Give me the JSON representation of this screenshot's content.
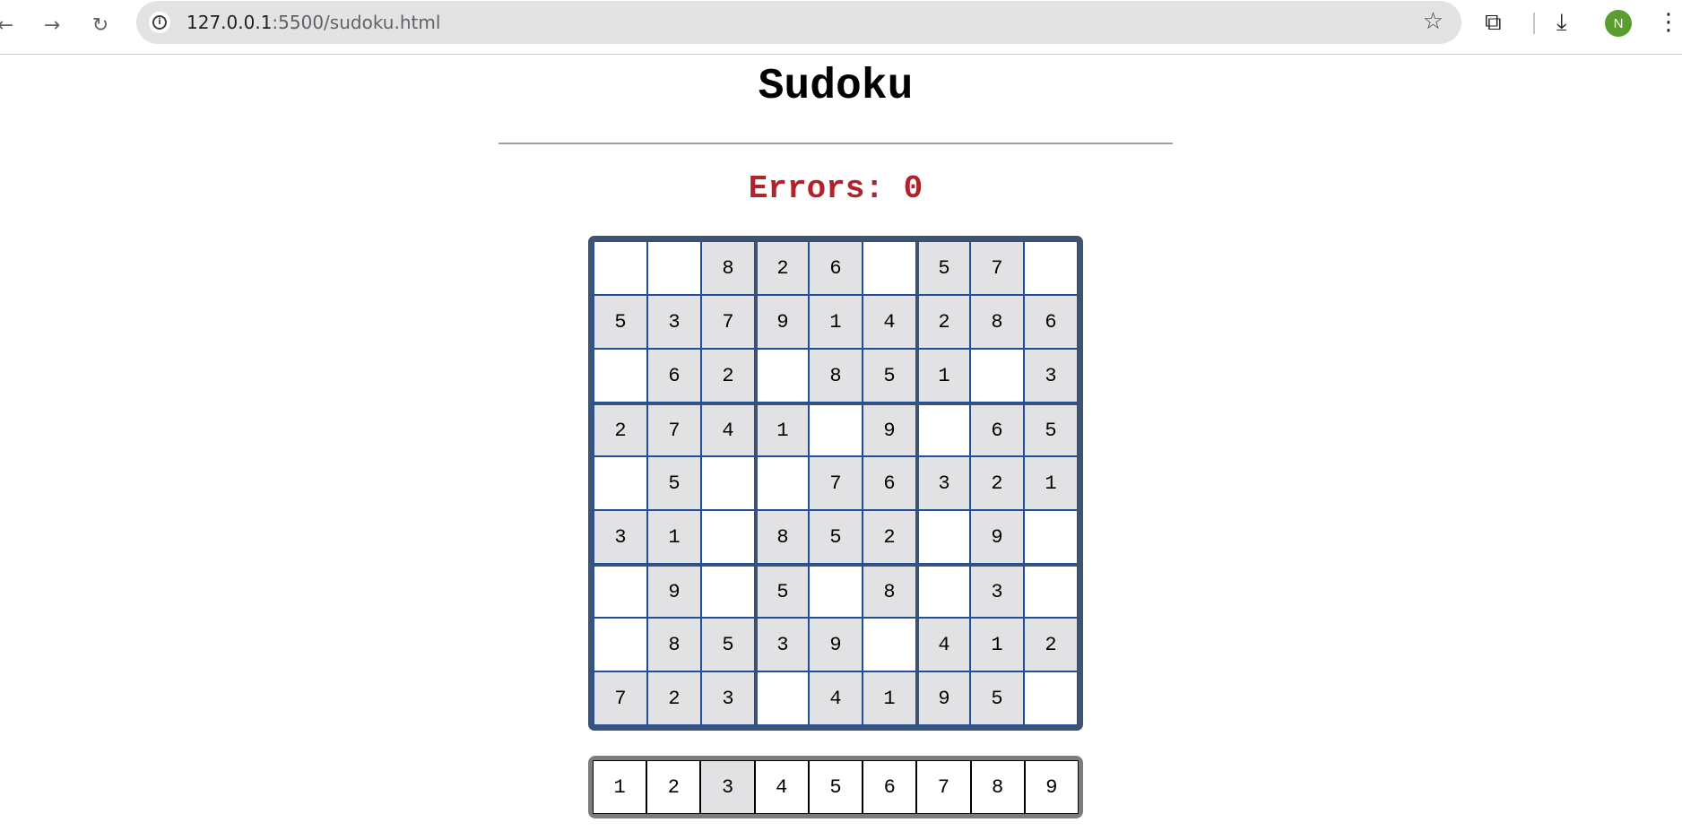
{
  "browser": {
    "url_host": "127.0.0.1",
    "url_path": ":5500/sudoku.html",
    "profile_initial": "N"
  },
  "page": {
    "title": "Sudoku",
    "errors_text": "Errors: 0"
  },
  "board": [
    [
      "",
      "",
      "8",
      "2",
      "6",
      "",
      "5",
      "7",
      ""
    ],
    [
      "5",
      "3",
      "7",
      "9",
      "1",
      "4",
      "2",
      "8",
      "6"
    ],
    [
      "",
      "6",
      "2",
      "",
      "8",
      "5",
      "1",
      "",
      "3"
    ],
    [
      "2",
      "7",
      "4",
      "1",
      "",
      "9",
      "",
      "6",
      "5"
    ],
    [
      "",
      "5",
      "",
      "",
      "7",
      "6",
      "3",
      "2",
      "1"
    ],
    [
      "3",
      "1",
      "",
      "8",
      "5",
      "2",
      "",
      "9",
      ""
    ],
    [
      "",
      "9",
      "",
      "5",
      "",
      "8",
      "",
      "3",
      ""
    ],
    [
      "",
      "8",
      "5",
      "3",
      "9",
      "",
      "4",
      "1",
      "2"
    ],
    [
      "7",
      "2",
      "3",
      "",
      "4",
      "1",
      "9",
      "5",
      ""
    ]
  ],
  "digits": [
    "1",
    "2",
    "3",
    "4",
    "5",
    "6",
    "7",
    "8",
    "9"
  ],
  "selected_digit": "3",
  "colors": {
    "board_border": "#3e5371",
    "cell_border": "#1f4e9a",
    "given_cell_bg": "#e2e2e5",
    "errors_text": "#b0232a",
    "avatar_bg": "#5a9e2f"
  }
}
